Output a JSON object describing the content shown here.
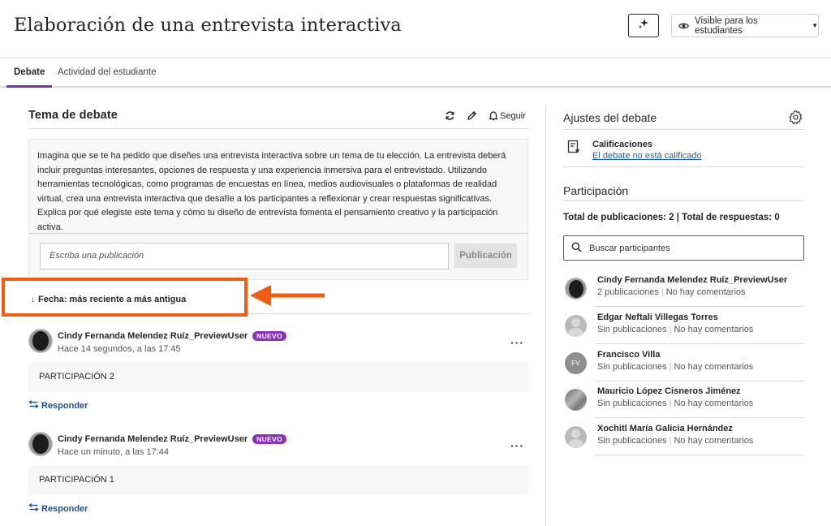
{
  "header": {
    "title": "Elaboración de una entrevista interactiva",
    "ai_icon": "sparkle-icon",
    "visibility_label": "Visible para los estudiantes"
  },
  "tabs": [
    {
      "label": "Debate",
      "active": true
    },
    {
      "label": "Actividad del estudiante",
      "active": false
    }
  ],
  "topic": {
    "title": "Tema de debate",
    "follow_label": "Seguir",
    "prompt": "Imagina que se te ha pedido que diseñes una entrevista interactiva sobre un tema de tu elección. La entrevista deberá incluir preguntas interesantes, opciones de respuesta y una experiencia inmersiva para el entrevistado. Utilizando herramientas tecnológicas, como programas de encuestas en línea, medios audiovisuales o plataformas de realidad virtual, crea una entrevista interactiva que desafíe a los participantes a reflexionar y crear respuestas significativas. Explica por qué elegiste este tema y cómo tu diseño de entrevista fomenta el pensamiento creativo y la participación activa.",
    "compose_placeholder": "Escriba una publicación",
    "publish_label": "Publicación"
  },
  "sort": {
    "label": "Fecha: más reciente a más antigua"
  },
  "annotation": {
    "color": "#f25b12"
  },
  "posts": [
    {
      "author": "Cindy Fernanda Melendez Ruíz_PreviewUser",
      "badge": "NUEVO",
      "time": "Hace 14 segundos, a las 17:45",
      "body": "PARTICIPACIÓN 2",
      "reply_label": "Responder"
    },
    {
      "author": "Cindy Fernanda Melendez Ruíz_PreviewUser",
      "badge": "NUEVO",
      "time": "Hace un minuto, a las 17:44",
      "body": "PARTICIPACIÓN 1",
      "reply_label": "Responder"
    }
  ],
  "settings": {
    "title": "Ajustes del debate",
    "grades_label": "Calificaciones",
    "grades_link": "El debate no está calificado"
  },
  "participation": {
    "title": "Participación",
    "totals": "Total de publicaciones: 2 | Total de respuestas: 0",
    "search_placeholder": "Buscar participantes",
    "participants": [
      {
        "name": "Cindy Fernanda Melendez Ruíz_PreviewUser",
        "posts": "2 publicaciones",
        "comments": "No hay comentarios",
        "avatar": "dark"
      },
      {
        "name": "Edgar Neftali Villegas Torres",
        "posts": "Sin publicaciones",
        "comments": "No hay comentarios",
        "avatar": "person"
      },
      {
        "name": "Francisco Villa",
        "posts": "Sin publicaciones",
        "comments": "No hay comentarios",
        "avatar": "initials",
        "initials": "FV"
      },
      {
        "name": "Mauricio López Cisneros Jiménez",
        "posts": "Sin publicaciones",
        "comments": "No hay comentarios",
        "avatar": "photo"
      },
      {
        "name": "Xochitl María Galicia Hernández",
        "posts": "Sin publicaciones",
        "comments": "No hay comentarios",
        "avatar": "person"
      }
    ]
  },
  "colors": {
    "accent": "#7b2fb5",
    "badge": "#8a2ec4",
    "link": "#1d5fae"
  }
}
